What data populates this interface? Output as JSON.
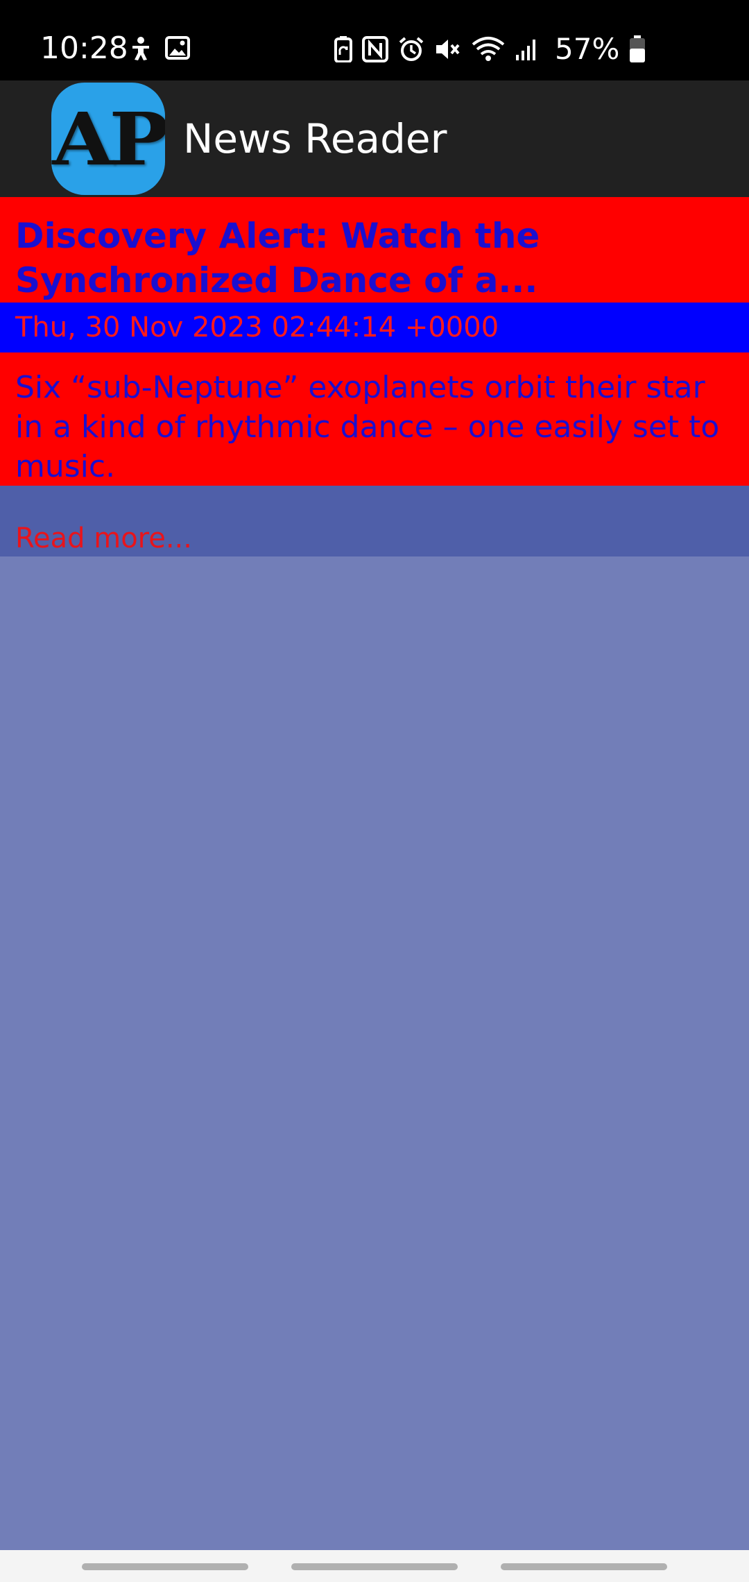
{
  "status_bar": {
    "time": "10:28",
    "left_icons": [
      "accessibility-icon",
      "image-icon"
    ],
    "right_icons": [
      "battery-saver-icon",
      "nfc-icon",
      "alarm-icon",
      "mute-icon",
      "wifi-icon",
      "signal-icon"
    ],
    "battery_percent": "57%",
    "battery_level": 0.57
  },
  "app_bar": {
    "logo_text": "AP",
    "title": "News Reader",
    "logo_color": "#2aa1e8",
    "background": "#212121"
  },
  "article": {
    "title": "Discovery Alert: Watch the Synchronized Dance of a...",
    "date": "Thu, 30 Nov 2023 02:44:14 +0000",
    "description": "Six “sub-Neptune” exoplanets orbit their star in a kind of rhythmic dance – one easily set to music.",
    "read_more": "Read more..."
  },
  "colors": {
    "title_bg": "#ff0000",
    "title_text": "#1a0fd0",
    "date_bg": "#0000ff",
    "date_text": "#ff1a1a",
    "link_row_bg": "#4f5fa9",
    "page_bg": "#727eb8"
  }
}
